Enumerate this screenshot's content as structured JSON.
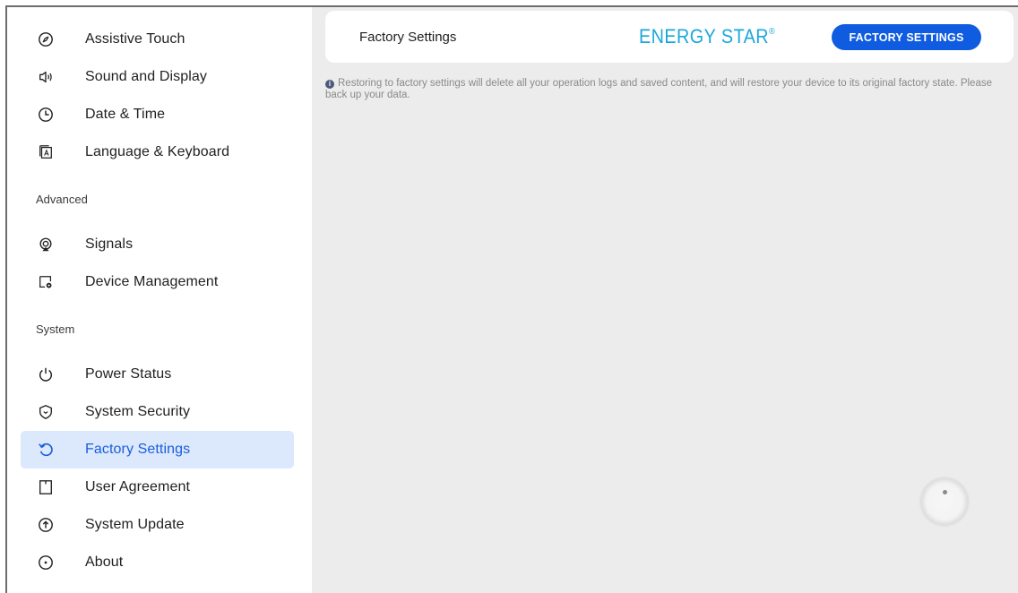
{
  "sidebar": {
    "items": [
      {
        "label": "Assistive Touch",
        "icon": "compass-icon"
      },
      {
        "label": "Sound and Display",
        "icon": "speaker-icon"
      },
      {
        "label": "Date & Time",
        "icon": "clock-icon"
      },
      {
        "label": "Language & Keyboard",
        "icon": "keyboard-language-icon"
      },
      {
        "label": "Signals",
        "icon": "signal-icon"
      },
      {
        "label": "Device Management",
        "icon": "device-gear-icon"
      },
      {
        "label": "Power Status",
        "icon": "power-icon"
      },
      {
        "label": "System Security",
        "icon": "shield-icon"
      },
      {
        "label": "Factory Settings",
        "icon": "restore-icon"
      },
      {
        "label": "User Agreement",
        "icon": "document-icon"
      },
      {
        "label": "System Update",
        "icon": "update-arrow-icon"
      },
      {
        "label": "About",
        "icon": "info-dot-icon"
      }
    ],
    "sections": {
      "advanced": "Advanced",
      "system": "System"
    },
    "active_item": "Factory Settings"
  },
  "header": {
    "title": "Factory Settings",
    "brand": "ENERGY STAR",
    "brand_mark": "®",
    "button_label": "FACTORY SETTINGS"
  },
  "info": {
    "icon": "info-icon",
    "text": "Restoring to factory settings will delete all your operation logs and saved content, and will restore your device to its original factory state. Please back up your data."
  },
  "colors": {
    "accent": "#0f5ce0",
    "active_bg": "#dce8fb",
    "brand": "#1ba7dc",
    "content_bg": "#ececec"
  }
}
